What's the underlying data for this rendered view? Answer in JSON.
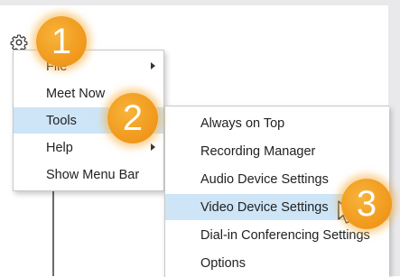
{
  "colors": {
    "highlight": "#cde5f7",
    "callout": "#f19b1f",
    "menu_border": "#c8c8c8"
  },
  "gear": {
    "icon": "gear-icon"
  },
  "main_menu": {
    "items": [
      {
        "label": "File",
        "has_submenu": true
      },
      {
        "label": "Meet Now",
        "has_submenu": false
      },
      {
        "label": "Tools",
        "has_submenu": true,
        "highlighted": true
      },
      {
        "label": "Help",
        "has_submenu": true
      },
      {
        "label": "Show Menu Bar",
        "has_submenu": false
      }
    ]
  },
  "tools_submenu": {
    "items": [
      {
        "label": "Always on Top"
      },
      {
        "label": "Recording Manager"
      },
      {
        "label": "Audio Device Settings"
      },
      {
        "label": "Video Device Settings",
        "highlighted": true
      },
      {
        "label": "Dial-in Conferencing Settings"
      },
      {
        "label": "Options"
      }
    ]
  },
  "callouts": {
    "one": "1",
    "two": "2",
    "three": "3"
  }
}
